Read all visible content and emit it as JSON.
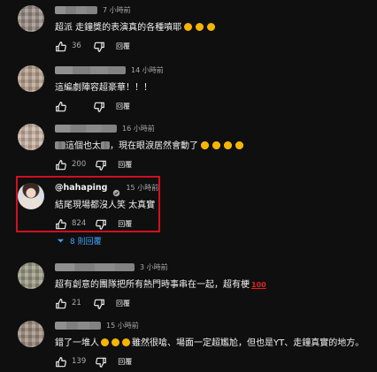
{
  "comments": [
    {
      "time": "7 小時前",
      "text": "超派 走鐘獎的表演真的各種噴耶",
      "likes": "36",
      "reply_label": "回覆"
    },
    {
      "time": "14 小時前",
      "text": "這編劇陣容超豪華！！！",
      "likes": "",
      "reply_label": "回覆"
    },
    {
      "time": "16 小時前",
      "text": "這個也太",
      "text_after": "，現在眼淚居然會動了",
      "likes": "200",
      "reply_label": "回覆"
    },
    {
      "author": "@hahaping",
      "time": "15 小時前",
      "text": "結尾現場都沒人笑 太真實",
      "likes": "824",
      "reply_label": "回覆"
    },
    {
      "time": "3 小時前",
      "text": "超有創意的團隊把所有熱門時事串在一起，超有梗",
      "likes": "21",
      "reply_label": "回覆"
    },
    {
      "time": "15 小時前",
      "text": "錯了一堆人",
      "text_after": "雖然很嗆、場面一定超尷尬，但也是YT、走鐘真實的地方。",
      "likes": "139",
      "reply_label": "回覆"
    }
  ],
  "replies_toggle": {
    "label": "8 則回覆"
  },
  "icons": {
    "like": "thumbs-up-icon",
    "dislike": "thumbs-down-icon",
    "verified": "verified-check-icon",
    "expand": "chevron-down-icon"
  },
  "colors": {
    "background": "#0f0f0f",
    "text": "#f1f1f1",
    "secondary": "#aaaaaa",
    "link": "#3ea6ff",
    "highlight": "#d0101e",
    "emoji": "#f7b500"
  }
}
